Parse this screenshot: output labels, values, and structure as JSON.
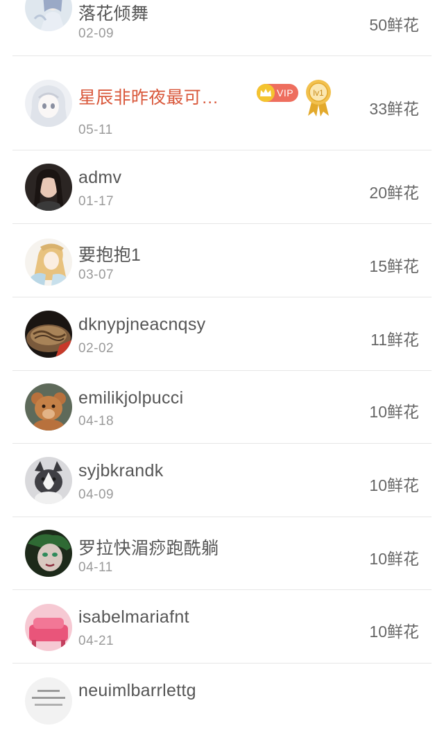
{
  "list": {
    "items": [
      {
        "name": "落花倾舞",
        "date": "02-09",
        "flowers": "50鲜花"
      },
      {
        "name": "星辰非昨夜最可…",
        "date": "05-11",
        "flowers": "33鲜花",
        "vip_label": "VIP",
        "level_label": "lv1"
      },
      {
        "name": "admv",
        "date": "01-17",
        "flowers": "20鲜花"
      },
      {
        "name": "要抱抱1",
        "date": "03-07",
        "flowers": "15鲜花"
      },
      {
        "name": "dknypjneacnqsy",
        "date": "02-02",
        "flowers": "11鲜花"
      },
      {
        "name": "emilikjolpucci",
        "date": "04-18",
        "flowers": "10鲜花"
      },
      {
        "name": "syjbkrandk",
        "date": "04-09",
        "flowers": "10鲜花"
      },
      {
        "name": "罗拉快湄痧跑酰躺",
        "date": "04-11",
        "flowers": "10鲜花"
      },
      {
        "name": "isabelmariafnt",
        "date": "04-21",
        "flowers": "10鲜花"
      },
      {
        "name": "neuimlbarrlettg",
        "date": "",
        "flowers": ""
      }
    ]
  },
  "colors": {
    "vip_name": "#d9583b",
    "vip_badge": "#ee6e5e",
    "crown": "#f4c430",
    "divider": "#e6e6e6"
  }
}
